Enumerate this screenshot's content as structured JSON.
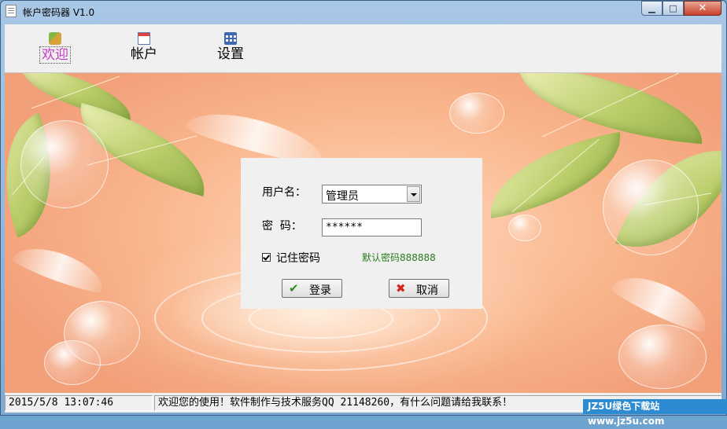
{
  "window": {
    "title": "帐户密码器 V1.0",
    "min_glyph": "▁",
    "max_glyph": "□",
    "close_glyph": "✕"
  },
  "toolbar": {
    "items": [
      {
        "label": "欢迎",
        "icon": "welcome-icon",
        "active": true
      },
      {
        "label": "帐户",
        "icon": "calendar-icon",
        "active": false
      },
      {
        "label": "设置",
        "icon": "settings-icon",
        "active": false
      }
    ]
  },
  "login": {
    "username_label": "用户名：",
    "username_value": "管理员",
    "password_label": "密  码：",
    "password_value": "******",
    "remember_label": "记住密码",
    "remember_checked": true,
    "hint": "默认密码888888",
    "login_button": "登录",
    "cancel_button": "取消",
    "login_icon": "check-icon",
    "cancel_icon": "x-icon"
  },
  "status": {
    "datetime": "2015/5/8 13:07:46",
    "message": "欢迎您的使用！软件制作与技术服务QQ 21148260，有什么问题请给我联系！"
  },
  "watermark": "JZ5U绿色下载站 www.jz5u.com",
  "colors": {
    "accent_active": "#c33bc5",
    "hint_green": "#2a7a1f",
    "close_red": "#c7402a"
  }
}
